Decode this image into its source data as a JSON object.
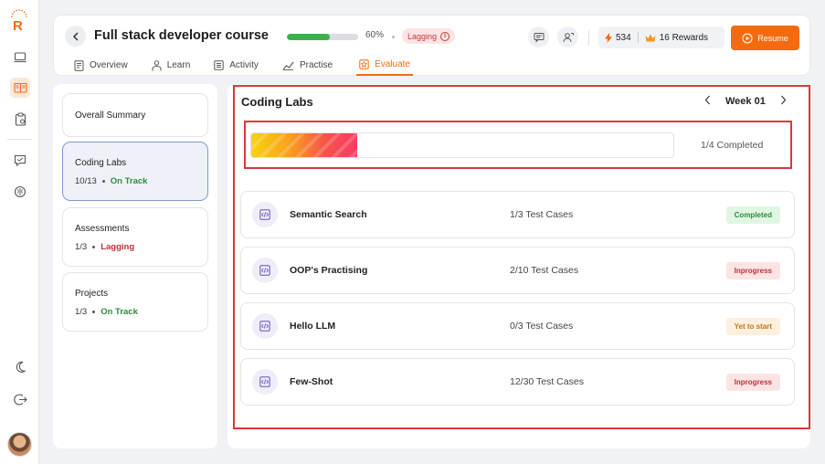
{
  "rail": {
    "logo_letter": "R",
    "icons": [
      "monitor-icon",
      "book-icon",
      "clipboard-icon",
      "chat-icon",
      "brain-icon",
      "moon-icon",
      "logout-icon"
    ]
  },
  "header": {
    "title": "Full stack developer course",
    "progress": 60,
    "progress_label": "60%",
    "status": "Lagging",
    "xp": "534",
    "rewards": "16 Rewards",
    "resume_label": "Resume"
  },
  "tabs": [
    {
      "label": "Overview",
      "icon": "document-icon"
    },
    {
      "label": "Learn",
      "icon": "person-icon"
    },
    {
      "label": "Activity",
      "icon": "list-icon"
    },
    {
      "label": "Practise",
      "icon": "chart-icon"
    },
    {
      "label": "Evaluate",
      "icon": "star-icon",
      "active": true
    }
  ],
  "sidebar": {
    "summary_label": "Overall Summary",
    "cards": [
      {
        "title": "Coding Labs",
        "count": "10/13",
        "status": "On Track",
        "active": true
      },
      {
        "title": "Assessments",
        "count": "1/3",
        "status": "Lagging"
      },
      {
        "title": "Projects",
        "count": "1/3",
        "status": "On Track"
      }
    ]
  },
  "main": {
    "title": "Coding Labs",
    "week_label": "Week 01",
    "completion_fraction": 0.25,
    "completion_text": "1/4 Completed",
    "labs": [
      {
        "name": "Semantic Search",
        "tests": "1/3 Test Cases",
        "status": "Completed"
      },
      {
        "name": "OOP's Practising",
        "tests": "2/10 Test Cases",
        "status": "Inprogress"
      },
      {
        "name": "Hello LLM",
        "tests": "0/3 Test Cases",
        "status": "Yet to start"
      },
      {
        "name": "Few-Shot",
        "tests": "12/30 Test Cases",
        "status": "Inprogress"
      }
    ]
  },
  "colors": {
    "accent": "#f46b0f",
    "on_track": "#2e8b3a",
    "lagging": "#c0303a",
    "highlight": "#d83a3a"
  }
}
